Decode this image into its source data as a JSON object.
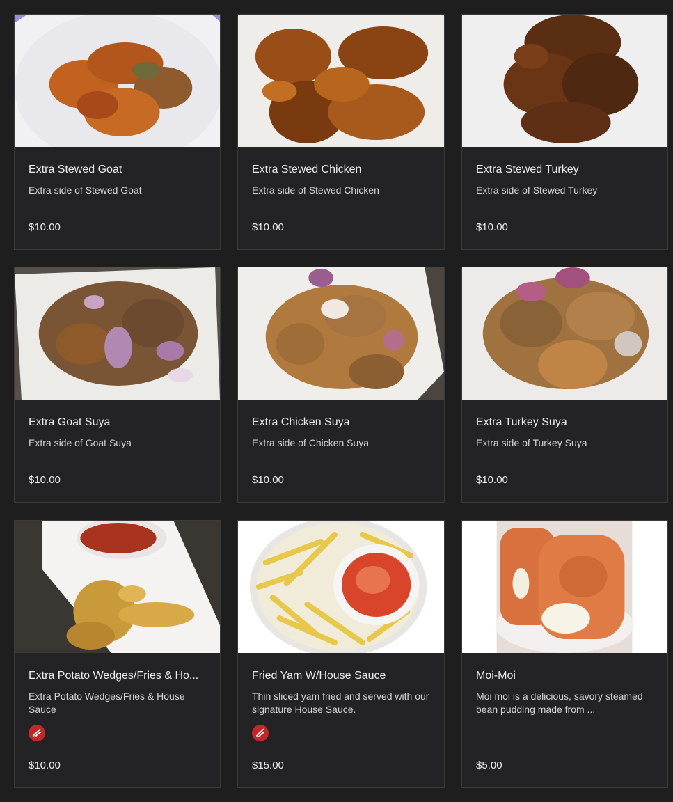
{
  "menu": {
    "items": [
      {
        "title": "Extra Stewed Goat",
        "description": "Extra side of Stewed Goat",
        "price": "$10.00",
        "image": "stewed-goat-photo",
        "spicy": false
      },
      {
        "title": "Extra Stewed Chicken",
        "description": "Extra side of Stewed Chicken",
        "price": "$10.00",
        "image": "stewed-chicken-photo",
        "spicy": false
      },
      {
        "title": "Extra Stewed Turkey",
        "description": "Extra side of Stewed Turkey",
        "price": "$10.00",
        "image": "stewed-turkey-photo",
        "spicy": false
      },
      {
        "title": "Extra Goat Suya",
        "description": "Extra side of Goat Suya",
        "price": "$10.00",
        "image": "goat-suya-photo",
        "spicy": false
      },
      {
        "title": "Extra Chicken Suya",
        "description": "Extra side of Chicken Suya",
        "price": "$10.00",
        "image": "chicken-suya-photo",
        "spicy": false
      },
      {
        "title": "Extra Turkey Suya",
        "description": "Extra side of Turkey Suya",
        "price": "$10.00",
        "image": "turkey-suya-photo",
        "spicy": false
      },
      {
        "title": "Extra Potato Wedges/Fries & Ho...",
        "description": "Extra Potato Wedges/Fries & House Sauce",
        "price": "$10.00",
        "image": "potato-wedges-photo",
        "spicy": true
      },
      {
        "title": "Fried Yam W/House Sauce",
        "description": "Thin sliced yam fried and served with our signature House Sauce.",
        "price": "$15.00",
        "image": "fried-yam-photo",
        "spicy": true
      },
      {
        "title": "Moi-Moi",
        "description": "Moi moi is a delicious, savory steamed bean pudding made from ...",
        "price": "$5.00",
        "image": "moi-moi-photo",
        "spicy": false
      }
    ]
  },
  "colors": {
    "background": "#1e1e1f",
    "card": "#232325",
    "border": "#3a3a3c",
    "spicy_badge": "#c0282a"
  },
  "icons": {
    "spicy": "chili-pepper-icon"
  }
}
